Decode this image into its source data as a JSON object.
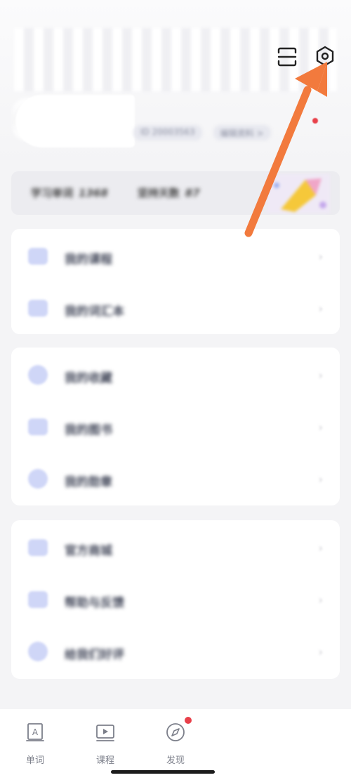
{
  "header": {
    "scan_icon": "scan-icon",
    "settings_icon": "settings-icon",
    "user_meta": [
      "ID 20003563",
      "编辑资料 >"
    ]
  },
  "stats": {
    "learned_label": "学习单词",
    "learned_value": "1368",
    "days_label": "坚持天数",
    "days_value": "87"
  },
  "menu_groups": [
    {
      "items": [
        {
          "icon": "course-icon",
          "label": "我的课程"
        },
        {
          "icon": "vocab-icon",
          "label": "我的词汇本"
        }
      ]
    },
    {
      "items": [
        {
          "icon": "favorite-icon",
          "label": "我的收藏"
        },
        {
          "icon": "book-icon",
          "label": "我的图书"
        },
        {
          "icon": "medal-icon",
          "label": "我的勋章"
        }
      ]
    },
    {
      "items": [
        {
          "icon": "shop-icon",
          "label": "官方商城"
        },
        {
          "icon": "feedback-icon",
          "label": "帮助与反馈"
        },
        {
          "icon": "thumbs-up-icon",
          "label": "给我们好评"
        }
      ]
    }
  ],
  "tabbar": {
    "tabs": [
      {
        "label": "单词",
        "icon": "word-icon"
      },
      {
        "label": "课程",
        "icon": "video-course-icon"
      },
      {
        "label": "发现",
        "icon": "compass-icon"
      }
    ]
  },
  "colors": {
    "accent_icon": "#cfd6f7",
    "annotation_arrow": "#f27a3d",
    "badge": "#e8404a"
  }
}
